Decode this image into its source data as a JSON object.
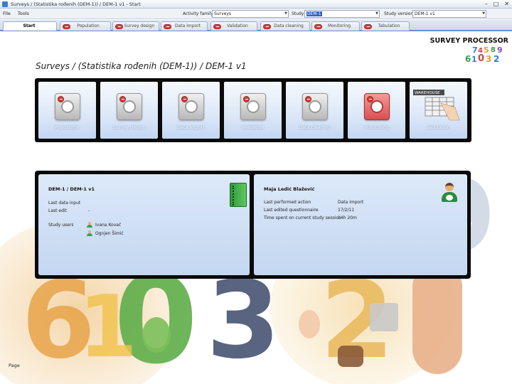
{
  "window": {
    "title": "Surveys / (Statistika rođenih (DEM-1)) / DEM-1 v1 - Start",
    "controls": [
      "–",
      "□",
      "✕"
    ]
  },
  "menu": {
    "items": [
      "File",
      "Tools"
    ]
  },
  "selectors": {
    "activity_label": "Activity family",
    "activity_value": "Surveys",
    "study_label": "Study",
    "study_value": "DEM-1",
    "version_label": "Study version",
    "version_value": "DEM-1 v1"
  },
  "tabs": [
    {
      "label": "Start",
      "active": true
    },
    {
      "label": "Population",
      "active": false
    },
    {
      "label": "Survey design",
      "active": false
    },
    {
      "label": "Data import",
      "active": false
    },
    {
      "label": "Validation",
      "active": false
    },
    {
      "label": "Data cleaning",
      "active": false
    },
    {
      "label": "Monitoring",
      "active": false
    },
    {
      "label": "Tabulation",
      "active": false
    }
  ],
  "brand": {
    "name": "SURVEY PROCESSOR",
    "logo_digits": [
      "7",
      "4",
      "5",
      "8",
      "9",
      "6",
      "1",
      "0",
      "3",
      "2"
    ]
  },
  "breadcrumb": "Surveys / (Statistika rođenih (DEM-1)) / DEM-1 v1",
  "modules": [
    {
      "label": "Population",
      "icon": "population-icon"
    },
    {
      "label": "Survey design",
      "icon": "survey-design-icon"
    },
    {
      "label": "Data import",
      "icon": "data-import-icon"
    },
    {
      "label": "Validation",
      "icon": "validation-icon"
    },
    {
      "label": "Data cleaning",
      "icon": "data-cleaning-icon"
    },
    {
      "label": "Monitoring",
      "icon": "monitoring-icon"
    },
    {
      "label": "Tabulation",
      "icon": "tabulation-icon"
    }
  ],
  "warehouse_label": "WAREHOUSE",
  "study_panel": {
    "title": "DEM-1 / DEM-1 v1",
    "last_data_input_label": "Last data input",
    "last_data_input_value": "",
    "last_edit_label": "Last edit",
    "last_edit_value": "-",
    "study_users_label": "Study users",
    "users": [
      "Ivana Kovač",
      "Ognjen Šimić"
    ]
  },
  "user_panel": {
    "name": "Maja Ledić Blažević",
    "last_performed_label": "Last performed action",
    "last_performed_value": "Data import",
    "last_edited_label": "Last edited questionnaire",
    "last_edited_value": "17/2/11",
    "time_label": "Time spent on current study session",
    "time_value": "14h 20m"
  },
  "statusbar": "Page",
  "colors": {
    "accent": "#6b8fc7",
    "panel_bg": "#cfdff4",
    "danger": "#d93b3b",
    "green": "#2f9a3a"
  }
}
